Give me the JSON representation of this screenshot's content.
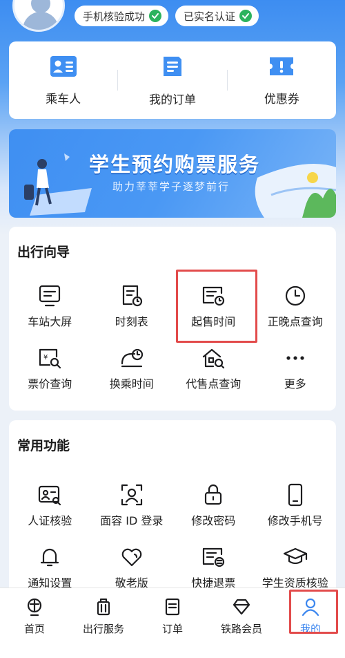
{
  "profile": {
    "badges": [
      "手机核验成功",
      "已实名认证"
    ]
  },
  "quick_actions": [
    {
      "label": "乘车人",
      "icon": "passenger-icon"
    },
    {
      "label": "我的订单",
      "icon": "order-icon"
    },
    {
      "label": "优惠券",
      "icon": "coupon-icon"
    }
  ],
  "banner": {
    "title": "学生预约购票服务",
    "subtitle": "助力莘莘学子逐梦前行"
  },
  "travel_guide": {
    "title": "出行向导",
    "items": [
      {
        "label": "车站大屏",
        "icon": "station-screen-icon"
      },
      {
        "label": "时刻表",
        "icon": "timetable-icon"
      },
      {
        "label": "起售时间",
        "icon": "sale-time-icon"
      },
      {
        "label": "正晚点查询",
        "icon": "clock-icon"
      },
      {
        "label": "票价查询",
        "icon": "fare-query-icon"
      },
      {
        "label": "换乘时间",
        "icon": "transfer-time-icon"
      },
      {
        "label": "代售点查询",
        "icon": "agency-query-icon"
      },
      {
        "label": "更多",
        "icon": "more-icon"
      }
    ]
  },
  "common_functions": {
    "title": "常用功能",
    "items": [
      {
        "label": "人证核验",
        "icon": "id-verify-icon"
      },
      {
        "label": "面容 ID 登录",
        "icon": "face-id-icon"
      },
      {
        "label": "修改密码",
        "icon": "lock-icon"
      },
      {
        "label": "修改手机号",
        "icon": "phone-icon"
      },
      {
        "label": "通知设置",
        "icon": "bell-icon"
      },
      {
        "label": "敬老版",
        "icon": "heart-icon"
      },
      {
        "label": "快捷退票",
        "icon": "refund-icon"
      },
      {
        "label": "学生资质核验",
        "icon": "graduation-cap-icon"
      }
    ]
  },
  "tabbar": {
    "active": "我的",
    "items": [
      {
        "label": "首页",
        "icon": "railway-logo-icon"
      },
      {
        "label": "出行服务",
        "icon": "luggage-icon"
      },
      {
        "label": "订单",
        "icon": "order-list-icon"
      },
      {
        "label": "铁路会员",
        "icon": "diamond-icon"
      },
      {
        "label": "我的",
        "icon": "user-icon"
      }
    ]
  },
  "colors": {
    "accent": "#3b86ef",
    "highlight_box": "#e24b4b",
    "verified_green": "#2db35e"
  }
}
